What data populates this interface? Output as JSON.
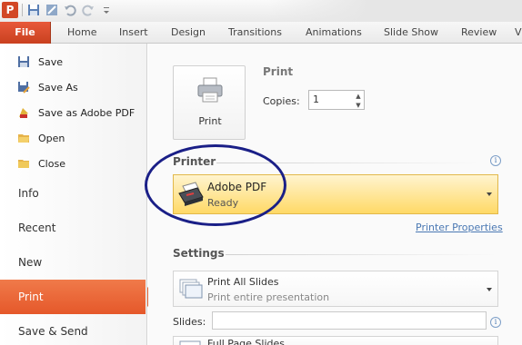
{
  "app": {
    "icon_letter": "P"
  },
  "ribbon": {
    "file_tab": "File",
    "tabs": [
      "Home",
      "Insert",
      "Design",
      "Transitions",
      "Animations",
      "Slide Show",
      "Review",
      "V"
    ]
  },
  "backstage": {
    "commands": [
      {
        "label": "Save",
        "icon": "save-icon"
      },
      {
        "label": "Save As",
        "icon": "save-as-icon"
      },
      {
        "label": "Save as Adobe PDF",
        "icon": "pdf-icon"
      },
      {
        "label": "Open",
        "icon": "folder-open-icon"
      },
      {
        "label": "Close",
        "icon": "folder-close-icon"
      }
    ],
    "tabs": [
      "Info",
      "Recent",
      "New",
      "Print",
      "Save & Send"
    ],
    "active_tab": "Print"
  },
  "print": {
    "button_label": "Print",
    "heading": "Print",
    "copies_label": "Copies:",
    "copies_value": "1"
  },
  "printer": {
    "section_title": "Printer",
    "name": "Adobe PDF",
    "status": "Ready",
    "properties_link": "Printer Properties"
  },
  "settings": {
    "section_title": "Settings",
    "range_name": "Print All Slides",
    "range_desc": "Print entire presentation",
    "slides_label": "Slides:",
    "slides_value": "",
    "layout_name": "Full Page Slides"
  },
  "colors": {
    "accent": "#e5582a",
    "highlight": "#ffd966",
    "annotation": "#1a1f87"
  }
}
